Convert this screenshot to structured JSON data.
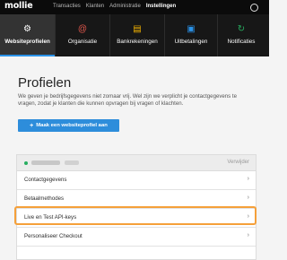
{
  "logo": "mollie",
  "topnav": [
    "Transacties",
    "Klanten",
    "Administratie",
    "Instellingen"
  ],
  "subnav": [
    {
      "label": "Websiteprofielen",
      "icon": "gear-icon",
      "glyph": "⚙",
      "color": "#ffffff"
    },
    {
      "label": "Organisatie",
      "icon": "at-icon",
      "glyph": "@",
      "color": "#e2574c"
    },
    {
      "label": "Bankrekeningen",
      "icon": "bank-icon",
      "glyph": "▤",
      "color": "#f5b400"
    },
    {
      "label": "Uitbetalingen",
      "icon": "wallet-icon",
      "glyph": "▣",
      "color": "#2a92e8"
    },
    {
      "label": "Notificaties",
      "icon": "refresh-icon",
      "glyph": "↻",
      "color": "#27ae60"
    }
  ],
  "page": {
    "title": "Profielen",
    "description": "We geven je bedrijfsgegevens niet zomaar vrij. Wel zijn we verplicht je contactgegevens te vragen, zodat je klanten die kunnen opvragen bij vragen of klachten.",
    "button": "Maak een websiteprofiel aan"
  },
  "card": {
    "delete": "Verwijder",
    "rows": [
      "Contactgegevens",
      "Betaalmethodes",
      "Live en Test API-keys",
      "Personaliseer Checkout"
    ]
  },
  "colors": {
    "accent": "#2d8ddb",
    "highlight": "#f5a03a",
    "status": "#27ae60"
  }
}
